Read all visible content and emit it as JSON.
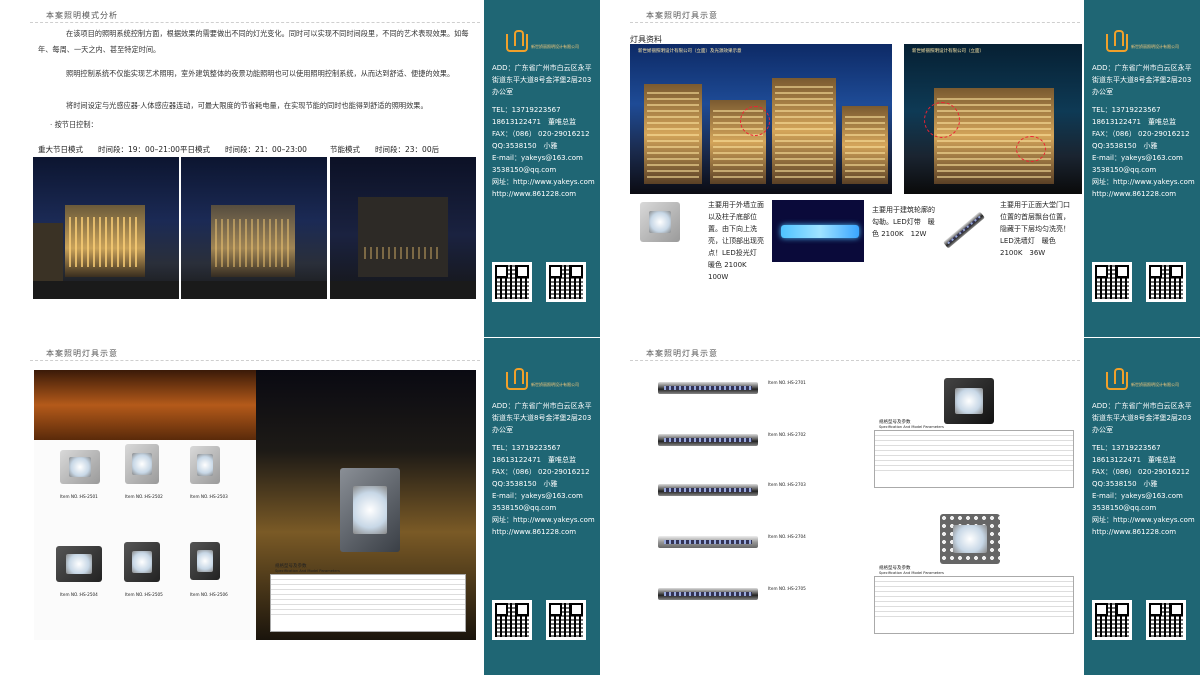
{
  "sidebar": {
    "logo_text": "新世娇丽照明设计有限公司",
    "address": "ADD：广东省广州市白云区永平街道东平大道8号金洋堡2层203办公室",
    "tel": "TEL：13719223567",
    "phone_contact": "18613122471　董唯总监",
    "fax": "FAX：（086） 020-29016212",
    "qq": "QQ:3538150　小雅",
    "email": "E-mail：yakeys@163.com",
    "email_qq": "3538150@qq.com",
    "website_label": "网址：http://www.yakeys.com",
    "website2": "http://www.861228.com"
  },
  "panel1": {
    "title": "本案照明模式分析",
    "paragraph1": "在该项目的照明系统控制方面，根据效果的需要做出不同的灯光变化。同时可以实现不同时间段里，不同的艺术表现效果。如每年、每周、一天之内、甚至特定时间。",
    "paragraph2": "照明控制系统不仅能实现艺术照明，室外建筑整体的夜景功能照明也可以使用照明控制系统，从而达到舒适、便捷的效果。",
    "paragraph3": "将时间设定与光感应器·人体感应器连动，可最大限度的节省耗电量，在实现节能的同时也能得到舒适的照明效果。",
    "paragraph4": "· 按节日控制：",
    "mode1": "重大节日模式　　时间段：19：00–21:00",
    "mode2": "平日模式　　时间段：21：00–23:00",
    "mode3": "节能模式　　时间段：23：00后"
  },
  "panel2": {
    "title": "本案照明灯具示意",
    "caption": "灯具资料",
    "photoA_caption": "新世娇丽照明设计有限公司（立面）及光源效果示意",
    "photoB_caption": "新世娇丽照明设计有限公司（立面）",
    "prod1_text": "主要用于外墙立面以及柱子底部位置。由下向上洗亮，让顶部出现亮点！LED投光灯　暖色 2100K　100W",
    "prod2_text": "主要用于建筑轮廓的勾勒。LED灯带　暖色 2100K　12W",
    "prod3_text": "主要用于正面大堂门口位置的首层飘台位置，隐藏于下层均匀洗亮！LED洗墙灯　暖色 2100K　36W"
  },
  "panel3": {
    "title": "本案照明灯具示意",
    "items": [
      "Item NO.:HS-2501",
      "Item NO.:HS-2502",
      "Item NO.:HS-2503",
      "Item NO.:HS-2504",
      "Item NO.:HS-2505",
      "Item NO.:HS-2506"
    ],
    "spec_title": "规格型号及参数",
    "spec_subtitle": "Specification And Model Parameters"
  },
  "panel4": {
    "title": "本案照明灯具示意",
    "items": [
      "Item NO.:HS-2701",
      "Item NO.:HS-2702",
      "Item NO.:HS-2703",
      "Item NO.:HS-2704",
      "Item NO.:HS-2705"
    ],
    "spec_title": "规格型号及参数",
    "spec_subtitle": "Specification And Model Parameters"
  }
}
